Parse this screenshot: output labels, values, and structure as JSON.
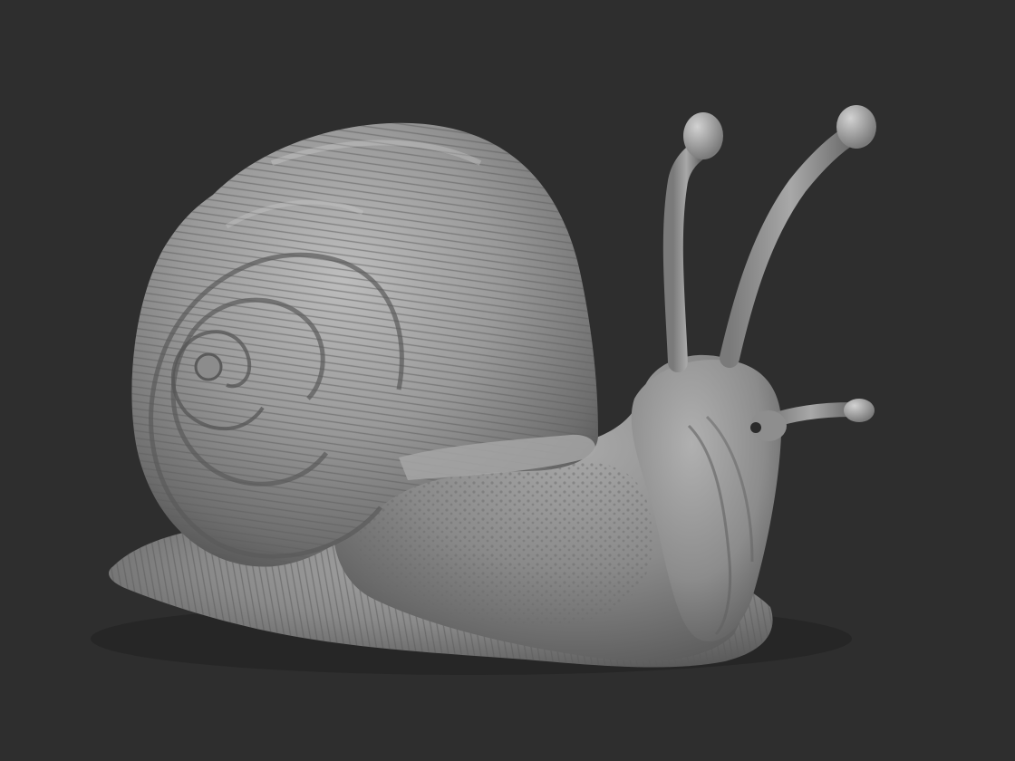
{
  "scene": {
    "subject": "snail-sculpt",
    "background_color": "#2e2e2e",
    "material_color": "#8a8a8a",
    "highlight_color": "#c4c4c4",
    "shadow_color": "#3a3a3a"
  }
}
